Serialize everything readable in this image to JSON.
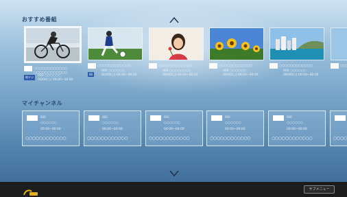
{
  "recommended": {
    "title": "おすすめ番組",
    "items": [
      {
        "scene": "cyclist",
        "dots": "○○○○○○○○○○○○",
        "dots2": "○○○○○○○○○○○○",
        "tag": "地デジ",
        "line1": "000 ○○○○○○",
        "line2": "00/00(○) 00:00~00:00"
      },
      {
        "scene": "soccer",
        "dots": "○○○○○○○○○○○○",
        "dots2": "",
        "tag": "BS",
        "line1": "000 ○○○○○○",
        "line2": "00/00(○) 00:00~00:00"
      },
      {
        "scene": "girl",
        "dots": "○○○○○○○○○○○○",
        "dots2": "",
        "tag": "",
        "line1": "000 ○○○○○○○○",
        "line2": "00/00(○) 00:00~00:00"
      },
      {
        "scene": "sunflower",
        "dots": "○○○○○○○○○○○○",
        "dots2": "",
        "tag": "",
        "line1": "000 ○○○○○○",
        "line2": "00/00(○) 00:00~00:00"
      },
      {
        "scene": "beach",
        "dots": "○○○○○○○○○○○○",
        "dots2": "",
        "tag": "",
        "line1": "000 ○○○○○○",
        "line2": "00/00(○) 00:00~00:00"
      },
      {
        "scene": "sky",
        "dots": "○○○○",
        "dots2": "",
        "tag": "",
        "line1": "",
        "line2": ""
      }
    ]
  },
  "my_channels": {
    "title": "マイチャンネル",
    "items": [
      {
        "num": "000",
        "name": "○○○○○○",
        "time": "00:00~00:00",
        "program": "○○○○○○○○○○○○"
      },
      {
        "num": "000",
        "name": "○○○○○○",
        "time": "00:00~00:00",
        "program": "○○○○○○○○○○○○"
      },
      {
        "num": "000",
        "name": "○○○○○○",
        "time": "00:00~00:00",
        "program": "○○○○○○○○○○○○"
      },
      {
        "num": "000",
        "name": "○○○○○○",
        "time": "00:00~00:00",
        "program": "○○○○○○○○○○○○"
      },
      {
        "num": "000",
        "name": "○○○○○○",
        "time": "00:00~00:00",
        "program": "○○○○○○○○○○○○"
      },
      {
        "num": "000",
        "name": "○○○○○○",
        "time": "00:00~00:00",
        "program": "○○○○○"
      }
    ]
  },
  "nav": {
    "up_icon": "chevron-up-icon",
    "down_icon": "chevron-down-icon"
  },
  "footer": {
    "logo_icon": "brand-logo-icon",
    "button_label": "サブメニュー"
  },
  "colors": {
    "accent_tag": "#2c5aa8",
    "footer_bg": "#1c1c1c",
    "section_title": "#2a4a6e"
  }
}
